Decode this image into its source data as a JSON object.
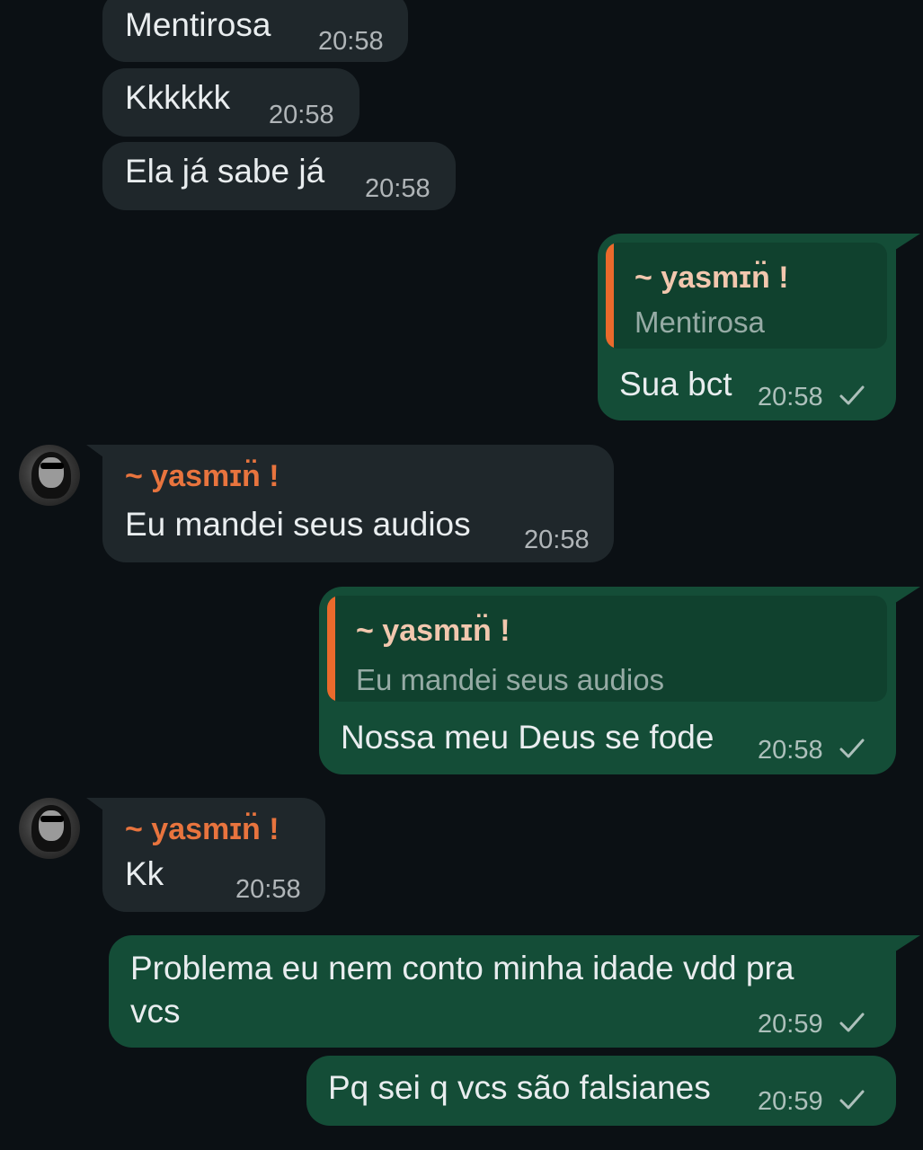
{
  "colors": {
    "background": "#0b1014",
    "incoming_bubble": "#1f272b",
    "outgoing_bubble": "#144d37",
    "sender_name": "#e8743e",
    "reply_bar": "#ea6a2c"
  },
  "messages": [
    {
      "text": "Mentirosa",
      "time": "20:58"
    },
    {
      "text": "Kkkkkk",
      "time": "20:58"
    },
    {
      "text": "Ela já sabe já",
      "time": "20:58"
    },
    {
      "reply_name": "~ yasmɪn̈ !",
      "reply_text": "Mentirosa",
      "text": "Sua bct",
      "time": "20:58",
      "status_icon": "single-check-icon"
    },
    {
      "sender": "~ yasmɪn̈ !",
      "text": "Eu mandei seus audios",
      "time": "20:58"
    },
    {
      "reply_name": "~ yasmɪn̈ !",
      "reply_text": "Eu mandei seus audios",
      "text": "Nossa meu Deus se fode",
      "time": "20:58",
      "status_icon": "single-check-icon"
    },
    {
      "sender": "~ yasmɪn̈ !",
      "text": "Kk",
      "time": "20:58"
    },
    {
      "text_line1": "Problema eu nem conto minha idade vdd pra",
      "text_line2": "vcs",
      "time": "20:59",
      "status_icon": "single-check-icon"
    },
    {
      "text": "Pq sei q vcs são falsianes",
      "time": "20:59",
      "status_icon": "single-check-icon"
    }
  ]
}
